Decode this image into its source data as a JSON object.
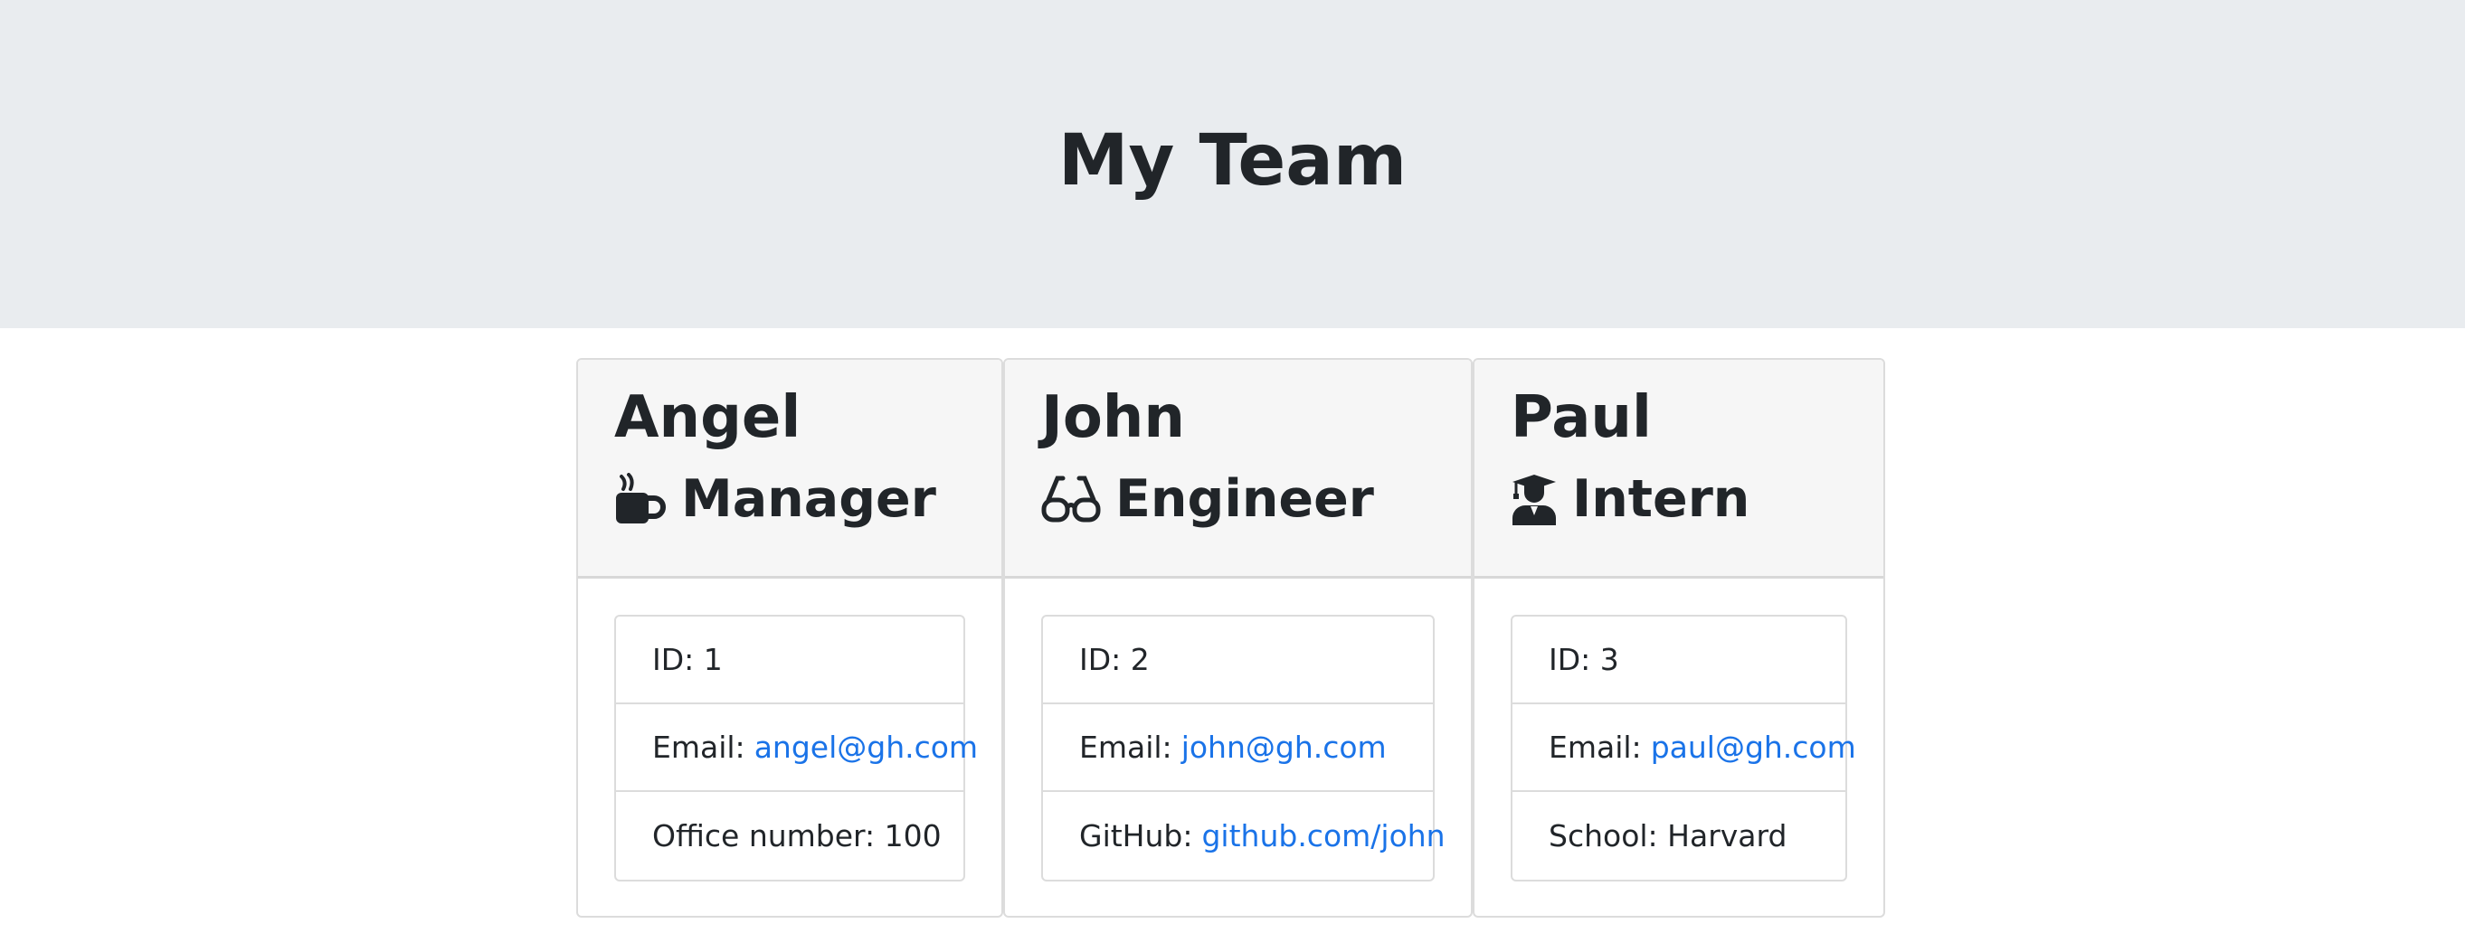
{
  "header": {
    "title": "My Team"
  },
  "colors": {
    "link": "#1a73e8",
    "jumbotron_bg": "#e9ecef",
    "card_header_bg": "#f6f6f6"
  },
  "cards": [
    {
      "name": "Angel",
      "role": "Manager",
      "role_icon": "coffee-mug-icon",
      "id_text": "ID: 1",
      "email_label": "Email:",
      "email": "angel@gh.com",
      "extra_label": "Office number: 100",
      "extra_link": ""
    },
    {
      "name": "John",
      "role": "Engineer",
      "role_icon": "glasses-icon",
      "id_text": "ID: 2",
      "email_label": "Email:",
      "email": "john@gh.com",
      "extra_label": "GitHub:",
      "extra_link": "github.com/john"
    },
    {
      "name": "Paul",
      "role": "Intern",
      "role_icon": "graduate-icon",
      "id_text": "ID: 3",
      "email_label": "Email:",
      "email": "paul@gh.com",
      "extra_label": "School: Harvard",
      "extra_link": ""
    }
  ]
}
